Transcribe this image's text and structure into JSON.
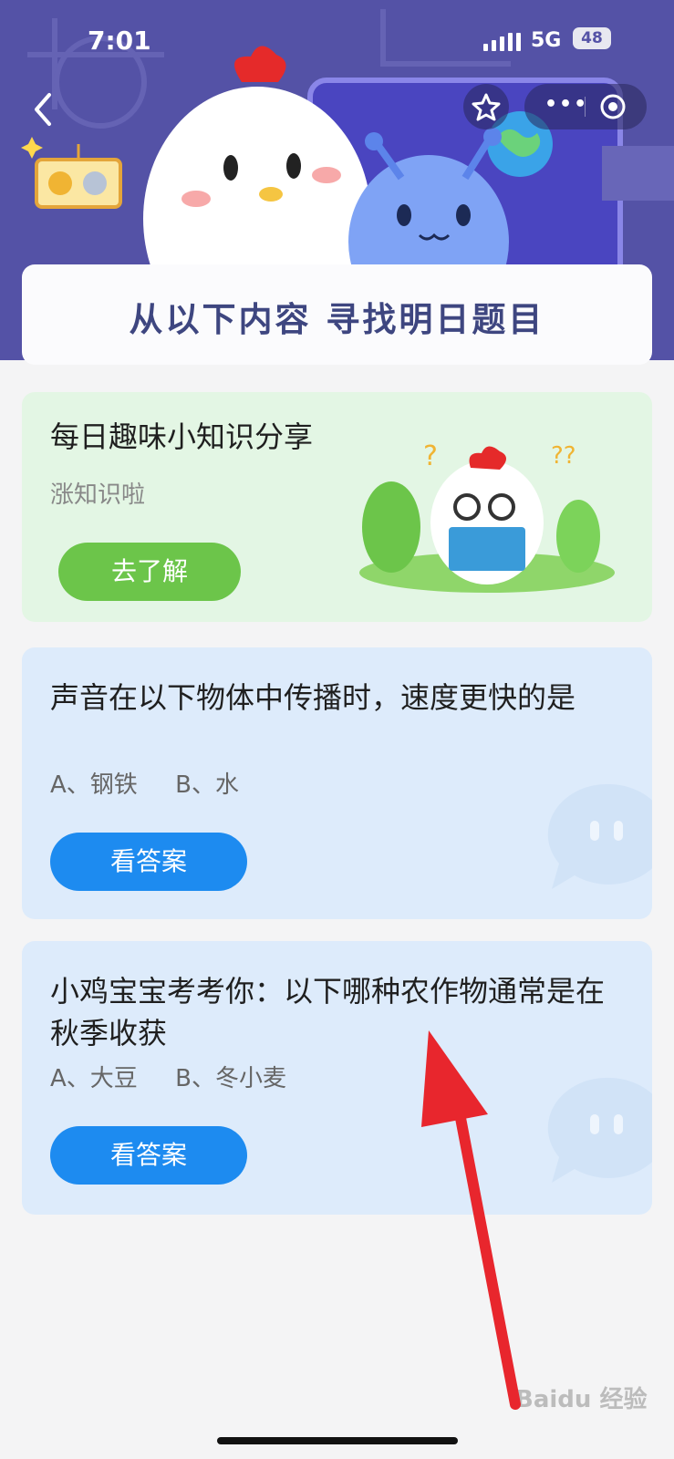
{
  "status_bar": {
    "time": "7:01",
    "network": "5G",
    "battery": "48"
  },
  "banner": {
    "title": "从以下内容 寻找明日题目"
  },
  "knowledge_card": {
    "title": "每日趣味小知识分享",
    "subtitle": "涨知识啦",
    "button": "去了解"
  },
  "questions": [
    {
      "question": "声音在以下物体中传播时，速度更快的是",
      "options": "A、钢铁     B、水",
      "button": "看答案"
    },
    {
      "question": "小鸡宝宝考考你：以下哪种农作物通常是在秋季收获",
      "options": "A、大豆     B、冬小麦",
      "button": "看答案"
    }
  ],
  "watermark": "Baidu 经验",
  "colors": {
    "header_bg": "#5452a6",
    "green_button": "#6cc54a",
    "blue_button": "#1d8bf0",
    "arrow": "#e8262d"
  },
  "icons": [
    "back-icon",
    "star-icon",
    "more-dots-icon",
    "target-icon",
    "signal-icon",
    "battery-icon"
  ]
}
